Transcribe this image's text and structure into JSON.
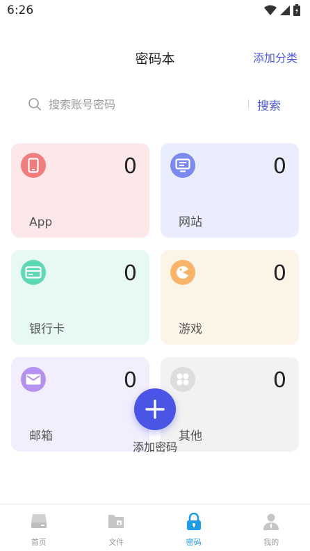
{
  "status": {
    "time": "6:26"
  },
  "header": {
    "title": "密码本",
    "add_category": "添加分类"
  },
  "search": {
    "placeholder": "搜索账号密码",
    "button": "搜索"
  },
  "categories": [
    {
      "label": "App",
      "count": "0",
      "bg": "#fce8e8",
      "icon_bg": "#f07c7c",
      "icon": "phone-icon"
    },
    {
      "label": "网站",
      "count": "0",
      "bg": "#eaedfd",
      "icon_bg": "#7c89ee",
      "icon": "monitor-icon"
    },
    {
      "label": "银行卡",
      "count": "0",
      "bg": "#e6f9f3",
      "icon_bg": "#5fd9b4",
      "icon": "card-icon"
    },
    {
      "label": "游戏",
      "count": "0",
      "bg": "#fdf4e8",
      "icon_bg": "#f7b46a",
      "icon": "gamepad-icon"
    },
    {
      "label": "邮箱",
      "count": "0",
      "bg": "#f2eefd",
      "icon_bg": "#b592f0",
      "icon": "mail-icon"
    },
    {
      "label": "其他",
      "count": "0",
      "bg": "#f2f2f2",
      "icon_bg": "#dddddd",
      "icon": "grid-icon"
    }
  ],
  "fab": {
    "label": "添加密码"
  },
  "tabs": [
    {
      "label": "首页",
      "icon": "home-icon"
    },
    {
      "label": "文件",
      "icon": "folder-icon"
    },
    {
      "label": "密码",
      "icon": "lock-icon",
      "active": true
    },
    {
      "label": "我的",
      "icon": "user-icon"
    }
  ],
  "colors": {
    "accent": "#4e5bd6",
    "fab": "#4a55e6",
    "active_tab": "#1e9be8"
  }
}
